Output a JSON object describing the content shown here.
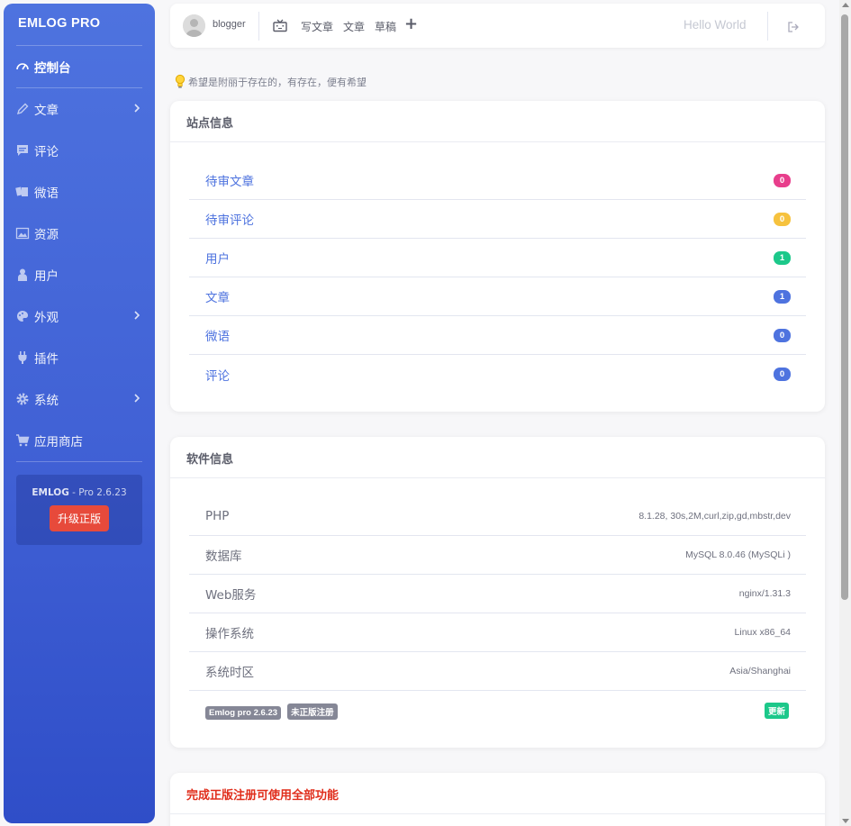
{
  "brand": "EMLOG PRO",
  "sidebar": {
    "items": [
      {
        "label": "控制台",
        "icon": "dashboard-icon"
      },
      {
        "label": "文章",
        "icon": "pencil-icon"
      },
      {
        "label": "评论",
        "icon": "comment-icon"
      },
      {
        "label": "微语",
        "icon": "cards-icon"
      },
      {
        "label": "资源",
        "icon": "image-icon"
      },
      {
        "label": "用户",
        "icon": "user-icon"
      },
      {
        "label": "外观",
        "icon": "palette-icon"
      },
      {
        "label": "插件",
        "icon": "plug-icon"
      },
      {
        "label": "系统",
        "icon": "gear-icon"
      },
      {
        "label": "应用商店",
        "icon": "cart-icon"
      }
    ],
    "version_name": "EMLOG",
    "version_text": " - Pro 2.6.23",
    "upgrade_label": "升级正版"
  },
  "topbar": {
    "username": "blogger",
    "write_label": "写文章",
    "articles_label": "文章",
    "drafts_label": "草稿",
    "add_label": "+",
    "site_title": "Hello World"
  },
  "motto": "希望是附丽于存在的，有存在，便有希望",
  "site_info": {
    "title": "站点信息",
    "rows": [
      {
        "label": "待审文章",
        "count": "0",
        "color": "#e83e8c"
      },
      {
        "label": "待审评论",
        "count": "0",
        "color": "#f6c23e"
      },
      {
        "label": "用户",
        "count": "1",
        "color": "#1cc88a"
      },
      {
        "label": "文章",
        "count": "1",
        "color": "#4e73df"
      },
      {
        "label": "微语",
        "count": "0",
        "color": "#4e73df"
      },
      {
        "label": "评论",
        "count": "0",
        "color": "#4e73df"
      }
    ]
  },
  "software_info": {
    "title": "软件信息",
    "rows": [
      {
        "label": "PHP",
        "value": "8.1.28, 30s,2M,curl,zip,gd,mbstr,dev"
      },
      {
        "label": "数据库",
        "value": "MySQL 8.0.46 (MySQLi )"
      },
      {
        "label": "Web服务",
        "value": "nginx/1.31.3"
      },
      {
        "label": "操作系统",
        "value": "Linux x86_64"
      },
      {
        "label": "系统时区",
        "value": "Asia/Shanghai"
      }
    ],
    "version_tag": "Emlog pro 2.6.23",
    "unregistered_tag": "未正版注册",
    "update_tag": "更新"
  },
  "register_card": {
    "title": "完成正版注册可使用全部功能"
  }
}
